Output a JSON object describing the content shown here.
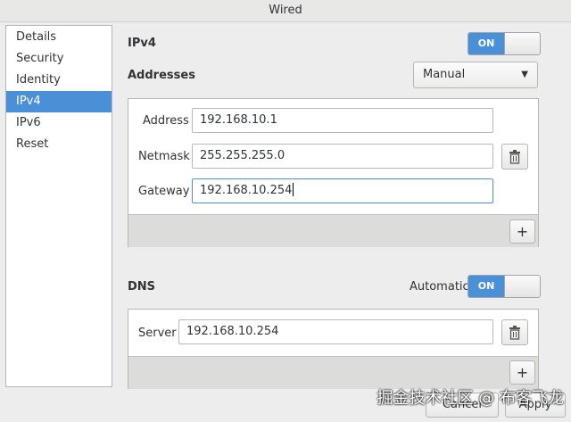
{
  "window": {
    "title": "Wired"
  },
  "sidebar": {
    "items": [
      {
        "label": "Details"
      },
      {
        "label": "Security"
      },
      {
        "label": "Identity"
      },
      {
        "label": "IPv4"
      },
      {
        "label": "IPv6"
      },
      {
        "label": "Reset"
      }
    ]
  },
  "ipv4": {
    "title": "IPv4",
    "toggle_label": "ON",
    "addresses_label": "Addresses",
    "method": "Manual",
    "fields": {
      "address": {
        "label": "Address",
        "value": "192.168.10.1"
      },
      "netmask": {
        "label": "Netmask",
        "value": "255.255.255.0"
      },
      "gateway": {
        "label": "Gateway",
        "value": "192.168.10.254"
      }
    },
    "add_label": "+"
  },
  "dns": {
    "title": "DNS",
    "automatic_label": "Automatic",
    "toggle_label": "ON",
    "server": {
      "label": "Server",
      "value": "192.168.10.254"
    },
    "add_label": "+"
  },
  "footer": {
    "cancel_label": "Cancel",
    "apply_label": "Apply"
  },
  "watermark": "掘金技术社区 @ 布客飞龙"
}
